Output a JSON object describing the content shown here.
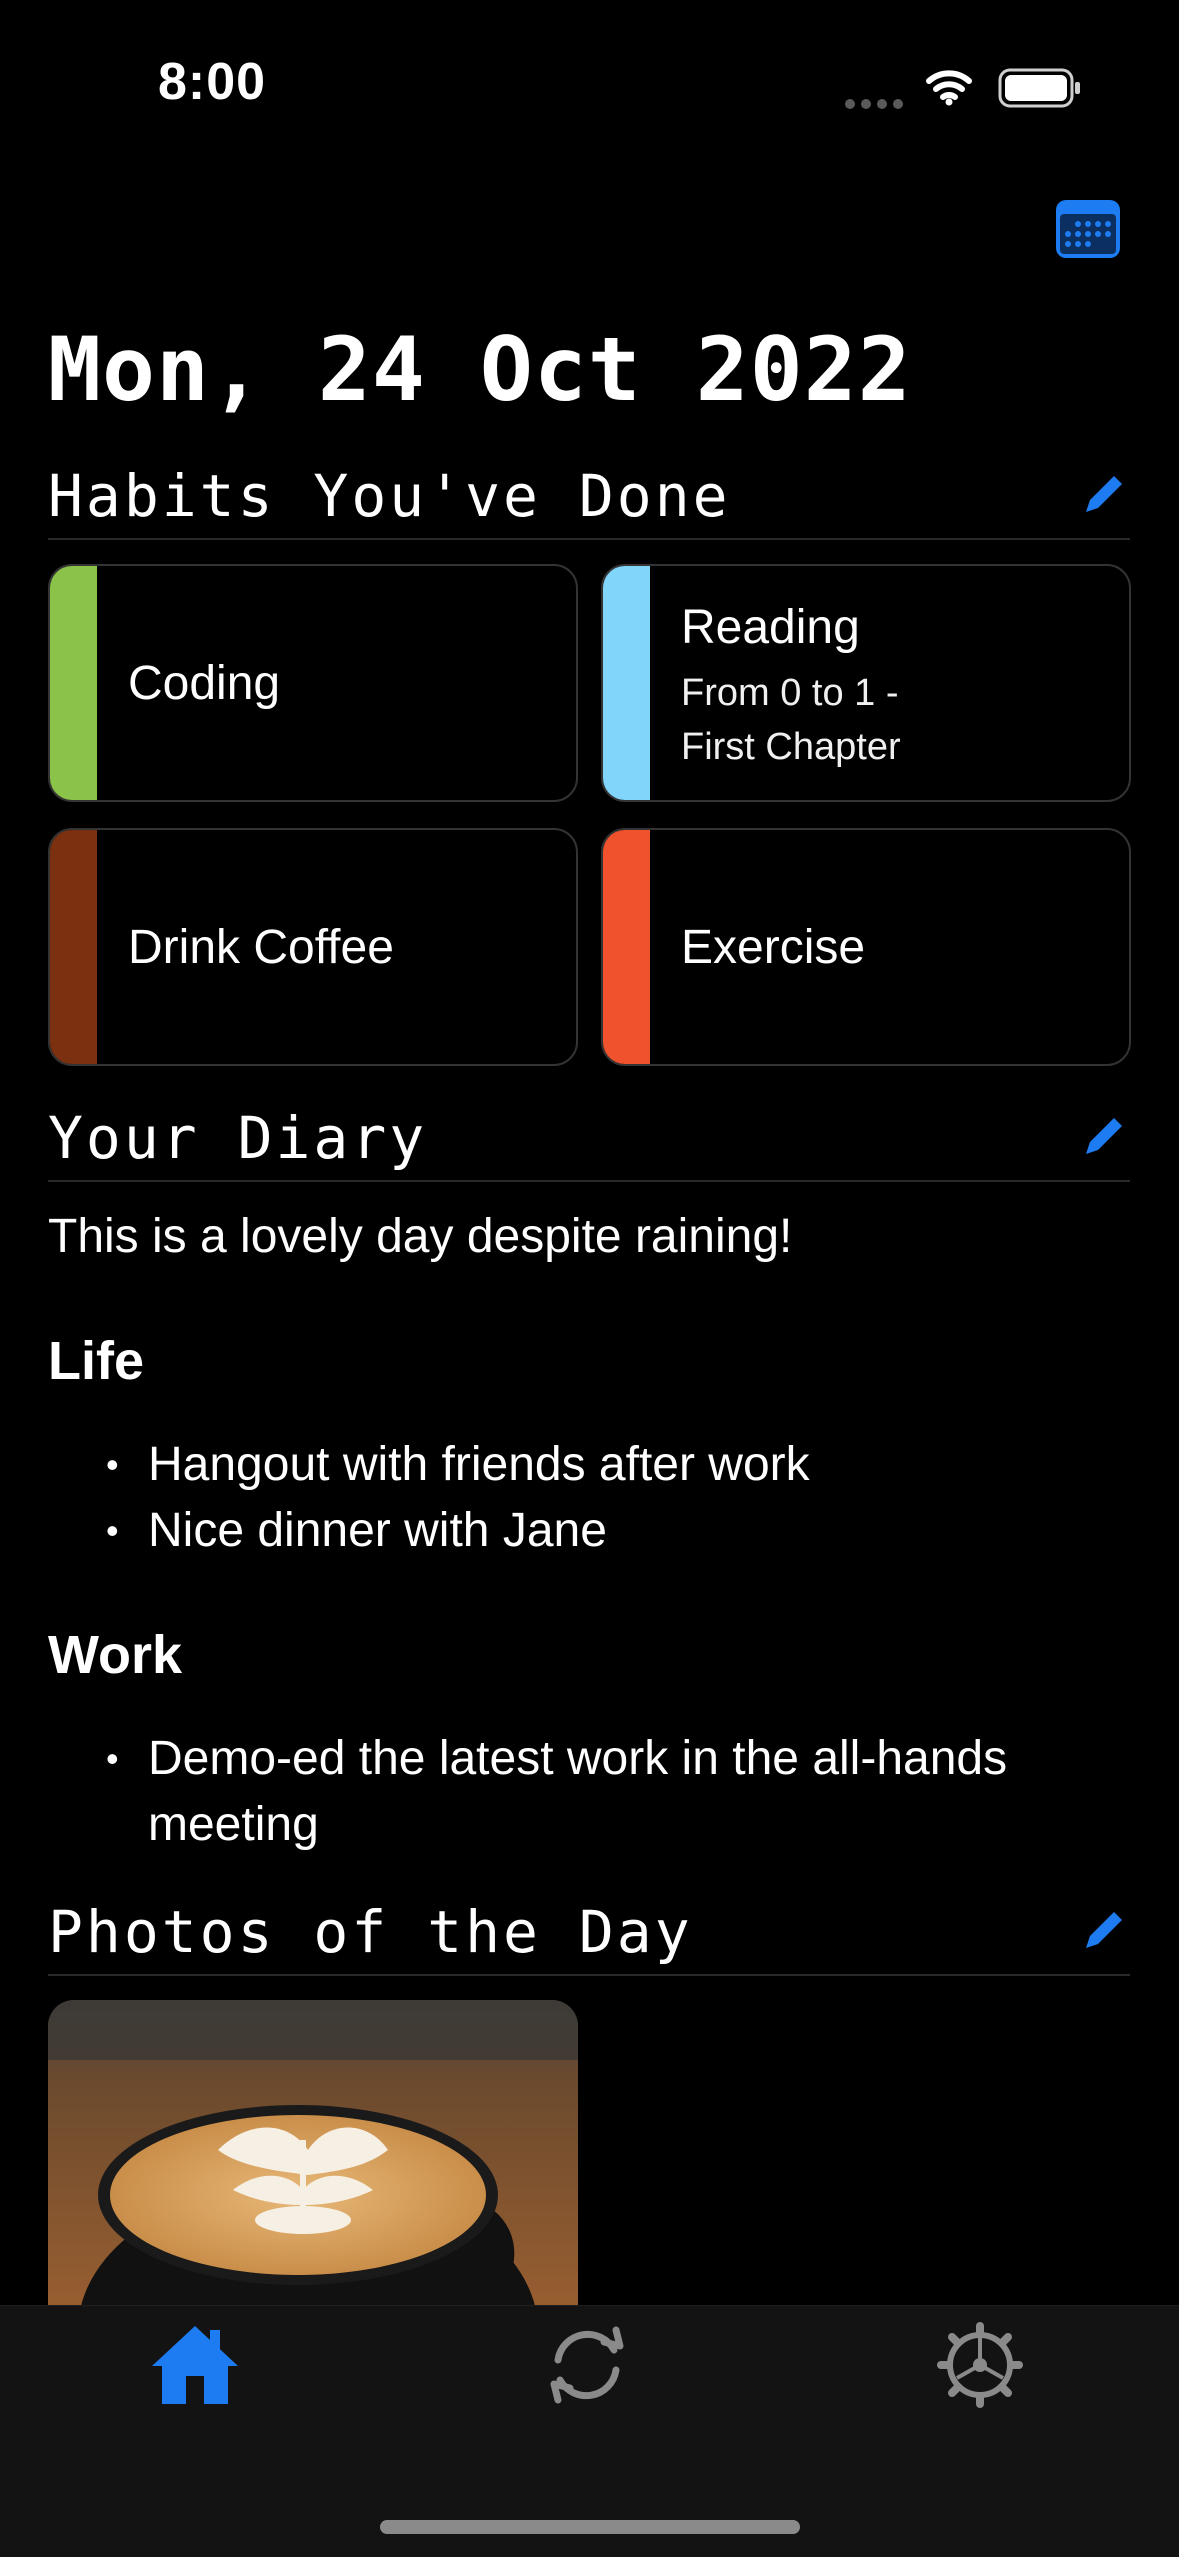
{
  "status_bar": {
    "time": "8:00"
  },
  "header": {
    "date": "Mon, 24 Oct 2022"
  },
  "habits": {
    "title": "Habits You've Done",
    "items": [
      {
        "label": "Coding",
        "color": "#8BC34A"
      },
      {
        "label": "Reading",
        "detail_line1": "From 0 to 1 -",
        "detail_line2": "First Chapter",
        "color": "#81D4FA"
      },
      {
        "label": "Drink Coffee",
        "color": "#7B3010"
      },
      {
        "label": "Exercise",
        "color": "#F0522D"
      }
    ]
  },
  "diary": {
    "title": "Your Diary",
    "intro": "This is a lovely day despite raining!",
    "sections": [
      {
        "heading": "Life",
        "items": [
          "Hangout with friends after work",
          "Nice dinner with Jane"
        ]
      },
      {
        "heading": "Work",
        "items": [
          "Demo-ed the latest work in the all-hands meeting"
        ]
      }
    ]
  },
  "photos": {
    "title": "Photos of the Day"
  },
  "tabbar": {
    "active": "home",
    "tabs": [
      "home",
      "sync",
      "settings"
    ]
  },
  "colors": {
    "accent": "#1E7CF2",
    "background": "#000000",
    "tabbar": "#131313"
  }
}
